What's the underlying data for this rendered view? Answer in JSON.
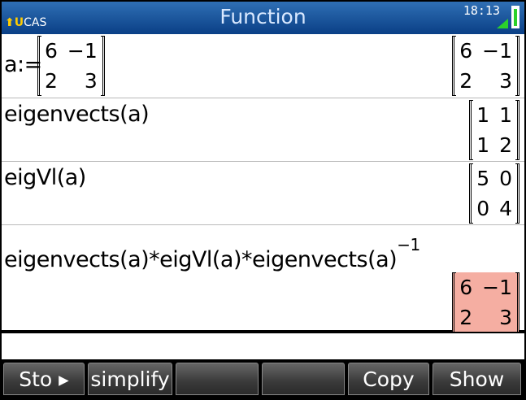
{
  "statusbar": {
    "angle_flag": "⬆U",
    "mode": "CAS",
    "title": "Function",
    "time": "18:13"
  },
  "history": [
    {
      "input": "a:=",
      "input_matrix": [
        [
          "6",
          "−1"
        ],
        [
          "2",
          "3"
        ]
      ],
      "result": [
        [
          "6",
          "−1"
        ],
        [
          "2",
          "3"
        ]
      ]
    },
    {
      "input": "eigenvects(a)",
      "result": [
        [
          "1",
          "1"
        ],
        [
          "1",
          "2"
        ]
      ]
    },
    {
      "input": "eigVl(a)",
      "result": [
        [
          "5",
          "0"
        ],
        [
          "0",
          "4"
        ]
      ]
    },
    {
      "input": "eigenvects(a)*eigVl(a)*eigenvects(a)",
      "input_exponent": "−1",
      "result": [
        [
          "6",
          "−1"
        ],
        [
          "2",
          "3"
        ]
      ],
      "selected": true
    }
  ],
  "command_line": "",
  "menu": {
    "sto": "Sto ▸",
    "simplify": "simplify",
    "blank1": "",
    "blank2": "",
    "copy": "Copy",
    "show": "Show"
  },
  "colors": {
    "titlebar": "#1a56a0",
    "selection": "#f5aea2",
    "battery": "#2bd12b"
  }
}
